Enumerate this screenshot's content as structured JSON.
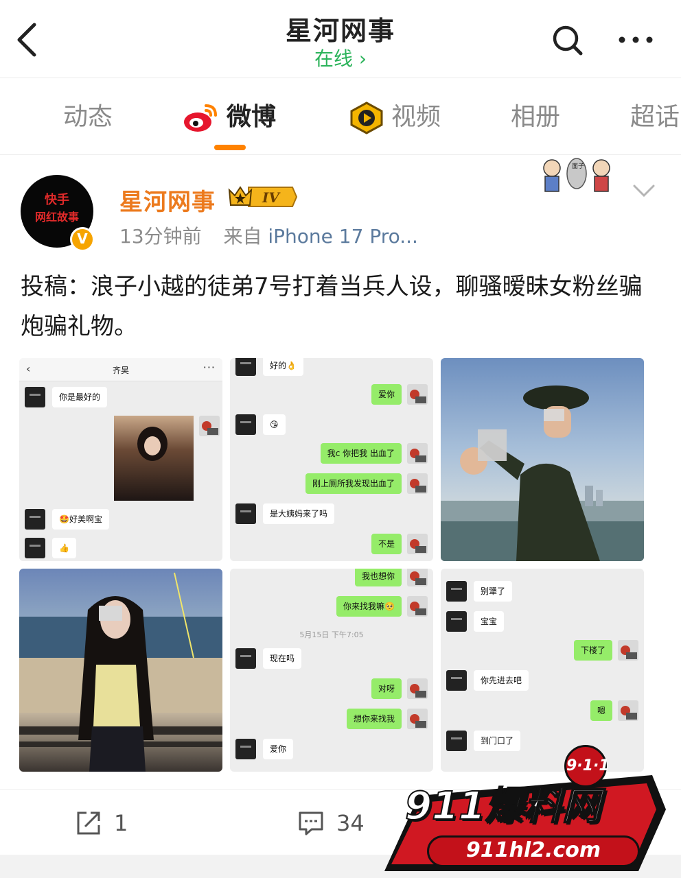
{
  "header": {
    "title": "星河网事",
    "subtitle": "在线 ›"
  },
  "tabs": [
    {
      "label": "动态"
    },
    {
      "label": "微博"
    },
    {
      "label": "视频"
    },
    {
      "label": "相册"
    },
    {
      "label": "超话"
    }
  ],
  "post": {
    "avatar_text_line1": "快手",
    "avatar_text_line2": "网红故事",
    "author": "星河网事",
    "level": "IV",
    "time": "13分钟前",
    "source_prefix": "来自",
    "source_device": "iPhone 17 Pro...",
    "text": "投稿：浪子小越的徒弟7号打着当兵人设，聊骚暧昧女粉丝骗炮骗礼物。",
    "sticker_text": "面子",
    "images": {
      "chat1": {
        "title": "齐昊",
        "back": "‹",
        "more": "···",
        "msgs": [
          "你是最好的",
          "🤩好美啊宝",
          "👍"
        ]
      },
      "chat2": {
        "msgs": [
          "好的👌",
          "爱你",
          "😘",
          "我c 你把我  出血了",
          "刚上厕所我发现出血了",
          "是大姨妈来了吗",
          "不是"
        ]
      },
      "chat3": {
        "timestamp": "5月15日 下午7:05",
        "msgs": [
          "我也想你",
          "你来找我嘛🥺",
          "现在吗",
          "对呀",
          "想你来找我",
          "爱你"
        ]
      },
      "chat4": {
        "msgs": [
          "别犟了",
          "宝宝",
          "下楼了",
          "你先进去吧",
          "嗯",
          "到门口了"
        ]
      }
    }
  },
  "actions": {
    "share_count": "1",
    "comment_count": "34"
  },
  "watermark": {
    "main": "911爆料网",
    "url": "911hl2.com",
    "badge": "9·1·1"
  },
  "colors": {
    "accent_orange": "#ff8200",
    "online_green": "#2bb35a",
    "author_orange": "#ec7a1d",
    "wechat_green": "#95ec69"
  },
  "icons": [
    "back-icon",
    "search-icon",
    "more-icon",
    "weibo-logo-icon",
    "video-icon",
    "verified-icon",
    "crown-icon",
    "chevron-down-icon",
    "share-icon",
    "comment-icon"
  ]
}
